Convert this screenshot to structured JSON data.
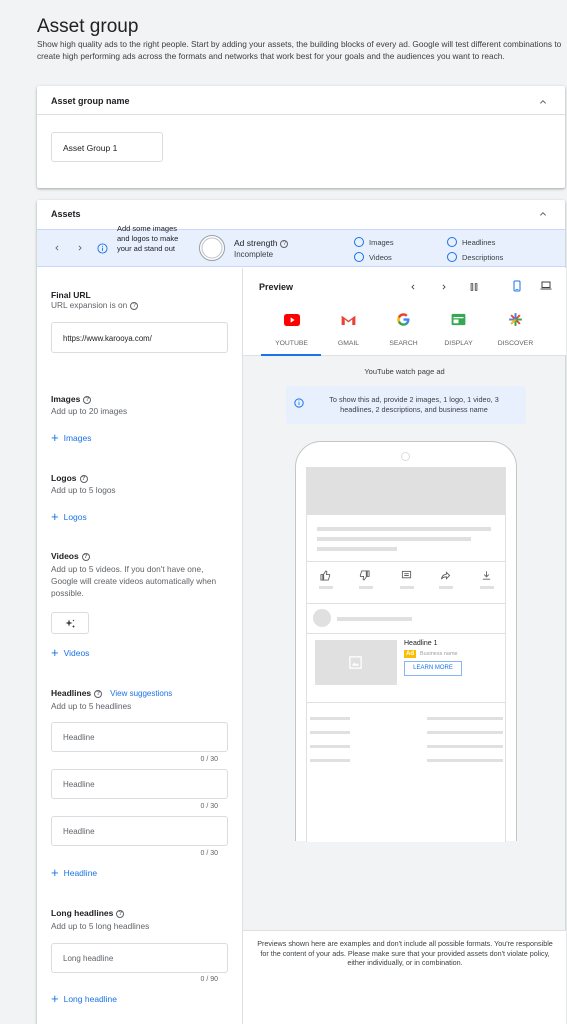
{
  "header": {
    "title": "Asset group",
    "description": "Show high quality ads to the right people. Start by adding your assets, the building blocks of every ad. Google will test different combinations to create high performing ads across the formats and networks that work best for your goals and the audiences you want to reach."
  },
  "name_card": {
    "title": "Asset group name",
    "value": "Asset Group 1"
  },
  "assets_card": {
    "title": "Assets",
    "tip": "Add some images and logos to make your ad stand out",
    "strength_label": "Ad strength",
    "strength_value": "Incomplete",
    "checklist": [
      "Images",
      "Videos",
      "Headlines",
      "Descriptions"
    ]
  },
  "form": {
    "final_url_title": "Final URL",
    "final_url_sub": "URL expansion is on",
    "final_url_value": "https://www.karooya.com/",
    "images_title": "Images",
    "images_sub": "Add up to 20 images",
    "images_add": "Images",
    "logos_title": "Logos",
    "logos_sub": "Add up to 5 logos",
    "logos_add": "Logos",
    "videos_title": "Videos",
    "videos_sub": "Add up to 5 videos. If you don't have one, Google will create videos automatically when possible.",
    "videos_add": "Videos",
    "headlines_title": "Headlines",
    "view_suggestions": "View suggestions",
    "headlines_sub": "Add up to 5 headlines",
    "headline_placeholder": "Headline",
    "headline_counter": "0 / 30",
    "headlines_add": "Headline",
    "long_title": "Long headlines",
    "long_sub": "Add up to 5 long headlines",
    "long_placeholder": "Long headline",
    "long_counter": "0 / 90",
    "long_add": "Long headline"
  },
  "preview": {
    "title": "Preview",
    "tabs": [
      "YOUTUBE",
      "GMAIL",
      "SEARCH",
      "DISPLAY",
      "DISCOVER"
    ],
    "active_tab": "YOUTUBE",
    "subtitle": "YouTube watch page ad",
    "info": "To show this ad, provide 2 images, 1 logo, 1 video, 3 headlines, 2 descriptions, and business name",
    "ad_headline": "Headline 1",
    "ad_badge": "Ad",
    "ad_business": "Business name",
    "ad_cta": "LEARN MORE",
    "footer": "Previews shown here are examples and don't include all possible formats. You're responsible for the content of your ads. Please make sure that your provided assets don't violate policy, either individually, or in combination."
  },
  "colors": {
    "accent": "#1a73e8",
    "tip_bg": "#e8f0fe",
    "badge": "#fbbc04"
  }
}
